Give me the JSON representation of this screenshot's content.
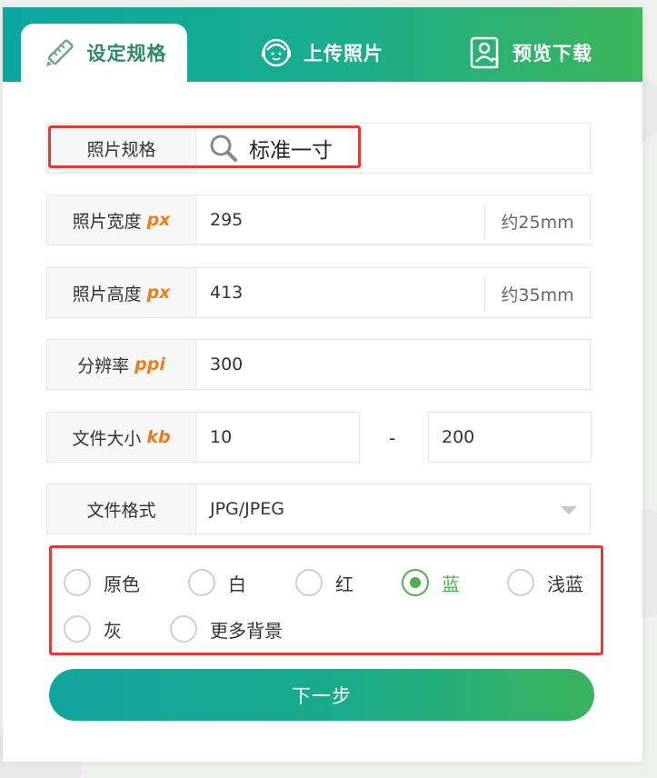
{
  "tabs": [
    {
      "label": "设定规格",
      "icon": "ruler-pencil-icon",
      "active": true
    },
    {
      "label": "上传照片",
      "icon": "avatar-upload-icon",
      "active": false
    },
    {
      "label": "预览下载",
      "icon": "portrait-card-icon",
      "active": false
    }
  ],
  "spec": {
    "label": "照片规格",
    "value": "标准一寸",
    "icon": "search-icon"
  },
  "width": {
    "label": "照片宽度",
    "unit": "px",
    "value": "295",
    "approx": "约25mm"
  },
  "height": {
    "label": "照片高度",
    "unit": "px",
    "value": "413",
    "approx": "约35mm"
  },
  "resolution": {
    "label": "分辨率",
    "unit": "ppi",
    "value": "300"
  },
  "filesize": {
    "label": "文件大小",
    "unit": "kb",
    "min": "10",
    "separator": "-",
    "max": "200"
  },
  "format": {
    "label": "文件格式",
    "value": "JPG/JPEG"
  },
  "background_options": [
    {
      "label": "原色",
      "checked": false
    },
    {
      "label": "白",
      "checked": false
    },
    {
      "label": "红",
      "checked": false
    },
    {
      "label": "蓝",
      "checked": true
    },
    {
      "label": "浅蓝",
      "checked": false
    },
    {
      "label": "灰",
      "checked": false
    },
    {
      "label": "更多背景",
      "checked": false
    }
  ],
  "next_button": "下一步",
  "colors": {
    "accent": "#1aab8a",
    "highlight": "#e53935",
    "unit": "#ef7d1a",
    "checked": "#4caf50"
  }
}
